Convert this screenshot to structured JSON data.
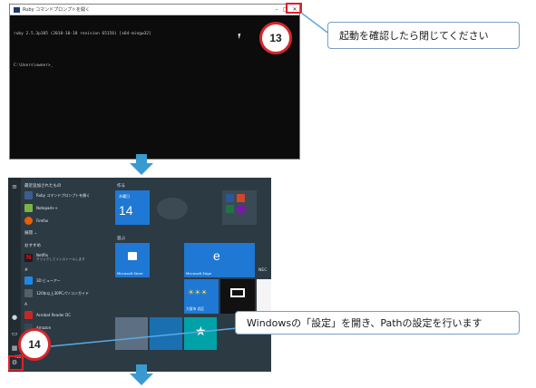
{
  "step13": {
    "badge": "13",
    "callout": "起動を確認したら閉じてください",
    "console_title": "Ruby コマンドプロンプトを開く",
    "console_lines": [
      "ruby 2.5.3p105 (2018-10-18 revision 65156) [x64-mingw32]",
      "",
      "C:\\Users\\owner>_"
    ],
    "window_controls": {
      "minimize": "–",
      "maximize": "□",
      "close": "✕"
    }
  },
  "step14": {
    "badge": "14",
    "callout": "Windowsの「設定」を開き、Pathの設定を行います"
  },
  "start_menu": {
    "recent_header": "最近追加されたもの",
    "recent_apps": [
      {
        "label": "Ruby コマンドプロンプトを開く",
        "icon": "console-icon",
        "color": "#3b5f8c"
      },
      {
        "label": "Notepad++",
        "icon": "notepad-icon",
        "color": "#7cb342"
      },
      {
        "label": "Firefox",
        "icon": "firefox-icon",
        "color": "#e66000"
      }
    ],
    "expand_label": "展開 ⌄",
    "recommended_header": "おすすめ",
    "recommended_apps": [
      {
        "label": "Netflix",
        "sub": "クリックしてインストールします",
        "icon": "netflix-icon",
        "color": "#e50914"
      }
    ],
    "hash_header": "#",
    "hash_apps": [
      {
        "label": "3D ビューアー",
        "icon": "cube-icon",
        "color": "#1e88e5"
      },
      {
        "label": "120年以上30PCパソコンガイド",
        "icon": "doc-icon",
        "color": "#555f66"
      }
    ],
    "a_header": "A",
    "a_apps": [
      {
        "label": "Acrobat Reader DC",
        "icon": "acrobat-icon",
        "color": "#c62828"
      },
      {
        "label": "Amazon",
        "icon": "amazon-icon",
        "color": "#37474f"
      }
    ],
    "group1": "作る",
    "group2": "遊ぶ",
    "calendar_day": "木曜日",
    "calendar_date": "14",
    "store_label": "Microsoft Store",
    "edge_label": "Microsoft Edge",
    "weather_label": "大阪市 北区",
    "nhk_label": "NEC",
    "section_label": "NEC"
  }
}
